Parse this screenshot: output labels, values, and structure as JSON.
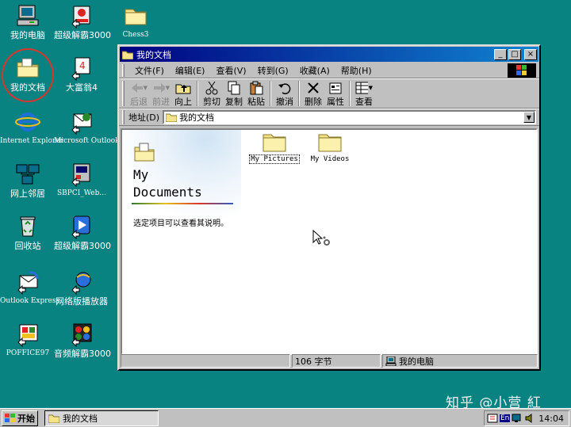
{
  "desktop": {
    "icons": [
      {
        "label": "我的电脑"
      },
      {
        "label": "超级解霸3000"
      },
      {
        "label": "Chess3"
      },
      {
        "label": "我的文档"
      },
      {
        "label": "大富翁4"
      },
      {
        "label": "Internet Explorer"
      },
      {
        "label": "Microsoft Outlook"
      },
      {
        "label": "网上邻居"
      },
      {
        "label": "SBPCI_Web..."
      },
      {
        "label": "回收站"
      },
      {
        "label": "超级解霸3000"
      },
      {
        "label": "Outlook Express"
      },
      {
        "label": "网络版播放器"
      },
      {
        "label": "POFFICE97"
      },
      {
        "label": "音频解霸3000"
      }
    ]
  },
  "window": {
    "title": "我的文档",
    "controls": {
      "minimize": "_",
      "maximize": "□",
      "close": "×"
    },
    "menu": [
      "文件(F)",
      "编辑(E)",
      "查看(V)",
      "转到(G)",
      "收藏(A)",
      "帮助(H)"
    ],
    "toolbar": {
      "back": "后退",
      "forward": "前进",
      "up": "向上",
      "cut": "剪切",
      "copy": "复制",
      "paste": "粘贴",
      "undo": "撤消",
      "delete": "删除",
      "properties": "属性",
      "views": "查看"
    },
    "address": {
      "label": "地址(D)",
      "value": "我的文档"
    },
    "webview": {
      "title_line1": "My",
      "title_line2": "Documents",
      "description": "选定项目可以查看其说明。"
    },
    "items": [
      "My Pictures",
      "My Videos"
    ],
    "status": {
      "count": "106 字节",
      "location": "我的电脑"
    }
  },
  "taskbar": {
    "start": "开始",
    "task": "我的文档",
    "tray_lang": "En",
    "clock": "14:04"
  },
  "watermark": "知乎 @小营 紅",
  "colors": {
    "desktop": "#098282",
    "titlebar_start": "#000080",
    "titlebar_end": "#1084d0",
    "face": "#c0c0c0"
  }
}
